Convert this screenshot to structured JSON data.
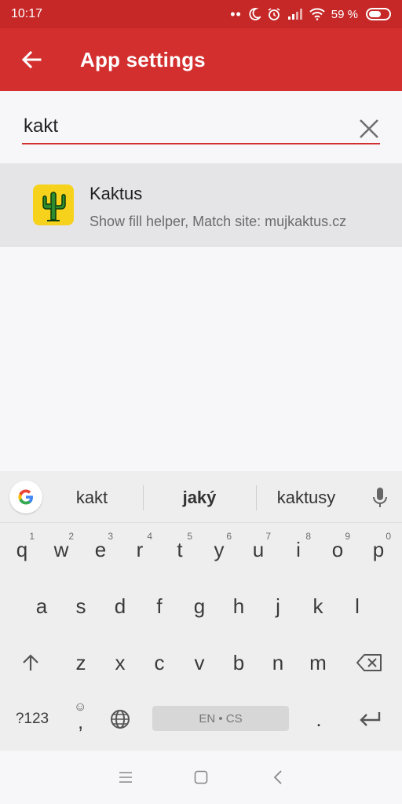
{
  "status_bar": {
    "time": "10:17",
    "battery": "59 %"
  },
  "app_bar": {
    "title": "App settings"
  },
  "search": {
    "value": "kakt"
  },
  "results": [
    {
      "title": "Kaktus",
      "subtitle": "Show fill helper, Match site: mujkaktus.cz"
    }
  ],
  "keyboard": {
    "suggestions": [
      "kakt",
      "jaký",
      "kaktusy"
    ],
    "row1": [
      {
        "key": "q",
        "hint": "1"
      },
      {
        "key": "w",
        "hint": "2"
      },
      {
        "key": "e",
        "hint": "3"
      },
      {
        "key": "r",
        "hint": "4"
      },
      {
        "key": "t",
        "hint": "5"
      },
      {
        "key": "y",
        "hint": "6"
      },
      {
        "key": "u",
        "hint": "7"
      },
      {
        "key": "i",
        "hint": "8"
      },
      {
        "key": "o",
        "hint": "9"
      },
      {
        "key": "p",
        "hint": "0"
      }
    ],
    "row2": [
      "a",
      "s",
      "d",
      "f",
      "g",
      "h",
      "j",
      "k",
      "l"
    ],
    "row3": [
      "z",
      "x",
      "c",
      "v",
      "b",
      "n",
      "m"
    ],
    "symbols_label": "?123",
    "comma": ",",
    "space_label": "EN • CS",
    "period": "."
  },
  "colors": {
    "primary": "#d32f2f",
    "status": "#c62828",
    "icon_bg": "#f7d21c"
  }
}
